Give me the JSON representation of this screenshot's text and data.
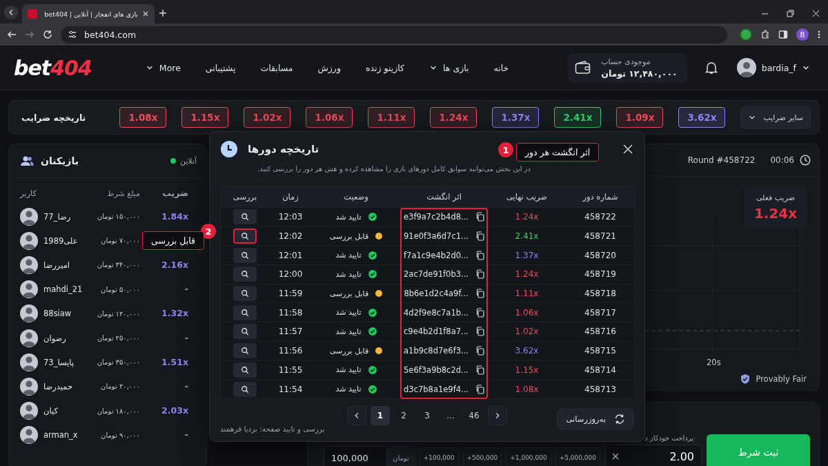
{
  "browser": {
    "tab_title": "بازی های انفجار | آنلاین | bet404",
    "url": "bet404.com",
    "profile_initial": "B"
  },
  "header": {
    "logo": {
      "prefix": "bet",
      "accent": "404"
    },
    "nav": [
      {
        "label": "خانه",
        "dropdown": false
      },
      {
        "label": "بازی ها",
        "dropdown": true
      },
      {
        "label": "کازینو زنده",
        "dropdown": false
      },
      {
        "label": "ورزش",
        "dropdown": false
      },
      {
        "label": "مسابقات",
        "dropdown": false
      },
      {
        "label": "پشتیبانی",
        "dropdown": false
      },
      {
        "label": "More",
        "dropdown": true
      }
    ],
    "balance": {
      "label": "موجودی حساب",
      "amount": "۱۲,۴۸۰,۰۰۰ تومان"
    },
    "username": "bardia_f"
  },
  "multiplier_history": {
    "title": "تاریخچه ضرایب",
    "more": "سایر ضرایب",
    "items": [
      {
        "value": "3.62x",
        "color": "#8b85f5"
      },
      {
        "value": "1.09x",
        "color": "#ef4b5a"
      },
      {
        "value": "2.41x",
        "color": "#2fd46d"
      },
      {
        "value": "1.37x",
        "color": "#8b85f5"
      },
      {
        "value": "1.24x",
        "color": "#ef4b5a"
      },
      {
        "value": "1.11x",
        "color": "#ef4b5a"
      },
      {
        "value": "1.06x",
        "color": "#ef4b5a"
      },
      {
        "value": "1.02x",
        "color": "#ef4b5a"
      },
      {
        "value": "1.15x",
        "color": "#ef4b5a"
      },
      {
        "value": "1.08x",
        "color": "#ef4b5a"
      }
    ]
  },
  "players": {
    "title": "بازیکنان",
    "online_label": "آنلاین",
    "columns": [
      "ضریب",
      "مبلغ شرط",
      "کاربر"
    ],
    "rows": [
      {
        "name": "رضا_77",
        "bet": "۱۵۰,۰۰۰ تومان",
        "multiplier": "1.84x",
        "color": "#8b85f5"
      },
      {
        "name": "علی1989",
        "bet": "۷۰,۰۰۰ تومان"
      },
      {
        "name": "امیررضا",
        "bet": "۳۴۰,۰۰۰ تومان",
        "multiplier": "2.16x",
        "color": "#8b85f5"
      },
      {
        "name": "mahdi_21",
        "bet": "۵۰,۰۰۰ تومان",
        "multiplier": "-",
        "color": "#9aa0aa"
      },
      {
        "name": "88siaw",
        "bet": "۱۲۰,۰۰۰ تومان",
        "multiplier": "1.32x",
        "color": "#8b85f5"
      },
      {
        "name": "رضوان",
        "bet": "۲۵۰,۰۰۰ تومان",
        "multiplier": "-",
        "color": "#9aa0aa"
      },
      {
        "name": "پایسا_73",
        "bet": "۳۵۰,۰۰۰ تومان",
        "multiplier": "1.51x",
        "color": "#8b85f5"
      },
      {
        "name": "حمیدرضا",
        "bet": "۲۰,۰۰۰ تومان",
        "multiplier": "-",
        "color": "#9aa0aa"
      },
      {
        "name": "کیان",
        "bet": "۱۸۰,۰۰۰ تومان",
        "multiplier": "2.03x",
        "color": "#8b85f5"
      },
      {
        "name": "arman_x",
        "bet": "۹۰,۰۰۰ تومان",
        "multiplier": "-",
        "color": "#9aa0aa"
      }
    ]
  },
  "game": {
    "round": "Round #458722",
    "timer": "00:06",
    "current_multiplier": {
      "label": "ضریب فعلی",
      "value": "1.24x"
    },
    "x_tick": "20s",
    "provably_fair": "Provably Fair"
  },
  "bet_panel": {
    "amount": "100,000",
    "currency": "تومان",
    "quick_adds": [
      "+5,000,000",
      "+1,000,000",
      "+500,000",
      "+100,000"
    ],
    "auto_cashout_label": "پرداخت خودکار د",
    "auto_cashout": "2.00",
    "submit": "ثبت شرط"
  },
  "history_modal": {
    "title": "تاریخچه دورها",
    "subtitle": "در این بخش می‌توانید سوابق کامل دورهای بازی را مشاهده کرده و هش هر دور را بررسی کنید.",
    "columns": [
      {
        "label": "شماره دور",
        "highlighted": false
      },
      {
        "label": "ضریب نهایی",
        "highlighted": false
      },
      {
        "label": "اثر انگشت",
        "highlighted": true
      },
      {
        "label": "وضعیت",
        "highlighted": false
      },
      {
        "label": "زمان",
        "highlighted": false
      },
      {
        "label": "بررسی",
        "highlighted": false
      }
    ],
    "rows": [
      {
        "round": "458722",
        "multiplier": "1.24x",
        "color": "#ef4b5a",
        "hash": "e3f9a7c2b4d8...",
        "kind": "verified",
        "status": "تایید شد",
        "time": "12:03",
        "highlighted": false
      },
      {
        "round": "458721",
        "multiplier": "2.41x",
        "color": "#2fd46d",
        "hash": "91e0f3a6d7c1...",
        "kind": "reviewable",
        "status": "قابل بررسی",
        "time": "12:02",
        "highlighted": true
      },
      {
        "round": "458720",
        "multiplier": "1.37x",
        "color": "#8b85f5",
        "hash": "f7a1c9e4b2d0...",
        "kind": "verified",
        "status": "تایید شد",
        "time": "12:01",
        "highlighted": false
      },
      {
        "round": "458719",
        "multiplier": "1.24x",
        "color": "#ef4b5a",
        "hash": "2ac7de91f0b3...",
        "kind": "verified",
        "status": "تایید شد",
        "time": "12:00",
        "highlighted": false
      },
      {
        "round": "458718",
        "multiplier": "1.11x",
        "color": "#ef4b5a",
        "hash": "8b6e1d2c4a9f...",
        "kind": "reviewable",
        "status": "قابل بررسی",
        "time": "11:59",
        "highlighted": false
      },
      {
        "round": "458717",
        "multiplier": "1.06x",
        "color": "#ef4b5a",
        "hash": "4d2f9e8c7a1b...",
        "kind": "verified",
        "status": "تایید شد",
        "time": "11:58",
        "highlighted": false
      },
      {
        "round": "458716",
        "multiplier": "1.02x",
        "color": "#ef4b5a",
        "hash": "c9e4b2d1f8a7...",
        "kind": "verified",
        "status": "تایید شد",
        "time": "11:57",
        "highlighted": false
      },
      {
        "round": "458715",
        "multiplier": "3.62x",
        "color": "#8b85f5",
        "hash": "a1b9c8d7e6f3...",
        "kind": "reviewable",
        "status": "قابل بررسی",
        "time": "11:56",
        "highlighted": false
      },
      {
        "round": "458714",
        "multiplier": "1.15x",
        "color": "#ef4b5a",
        "hash": "5e6f3a9b8c2d...",
        "kind": "verified",
        "status": "تایید شد",
        "time": "11:55",
        "highlighted": false
      },
      {
        "round": "458713",
        "multiplier": "1.08x",
        "color": "#ef4b5a",
        "hash": "d3c7b8a1e9f4...",
        "kind": "verified",
        "status": "تایید شد",
        "time": "11:54",
        "highlighted": false
      }
    ],
    "pagination": [
      {
        "label": "46",
        "selected": false
      },
      {
        "label": "...",
        "selected": false
      },
      {
        "label": "3",
        "selected": false
      },
      {
        "label": "2",
        "selected": false
      },
      {
        "label": "1",
        "selected": true
      }
    ],
    "refresh": "به‌روزرسانی",
    "footer": "بررسی و تایید صفحه: بردیا فرهمند"
  },
  "annotations": [
    {
      "number": "1",
      "label": "اثر انگشت هر دور"
    },
    {
      "number": "2",
      "label": "قابل بررسی"
    }
  ]
}
